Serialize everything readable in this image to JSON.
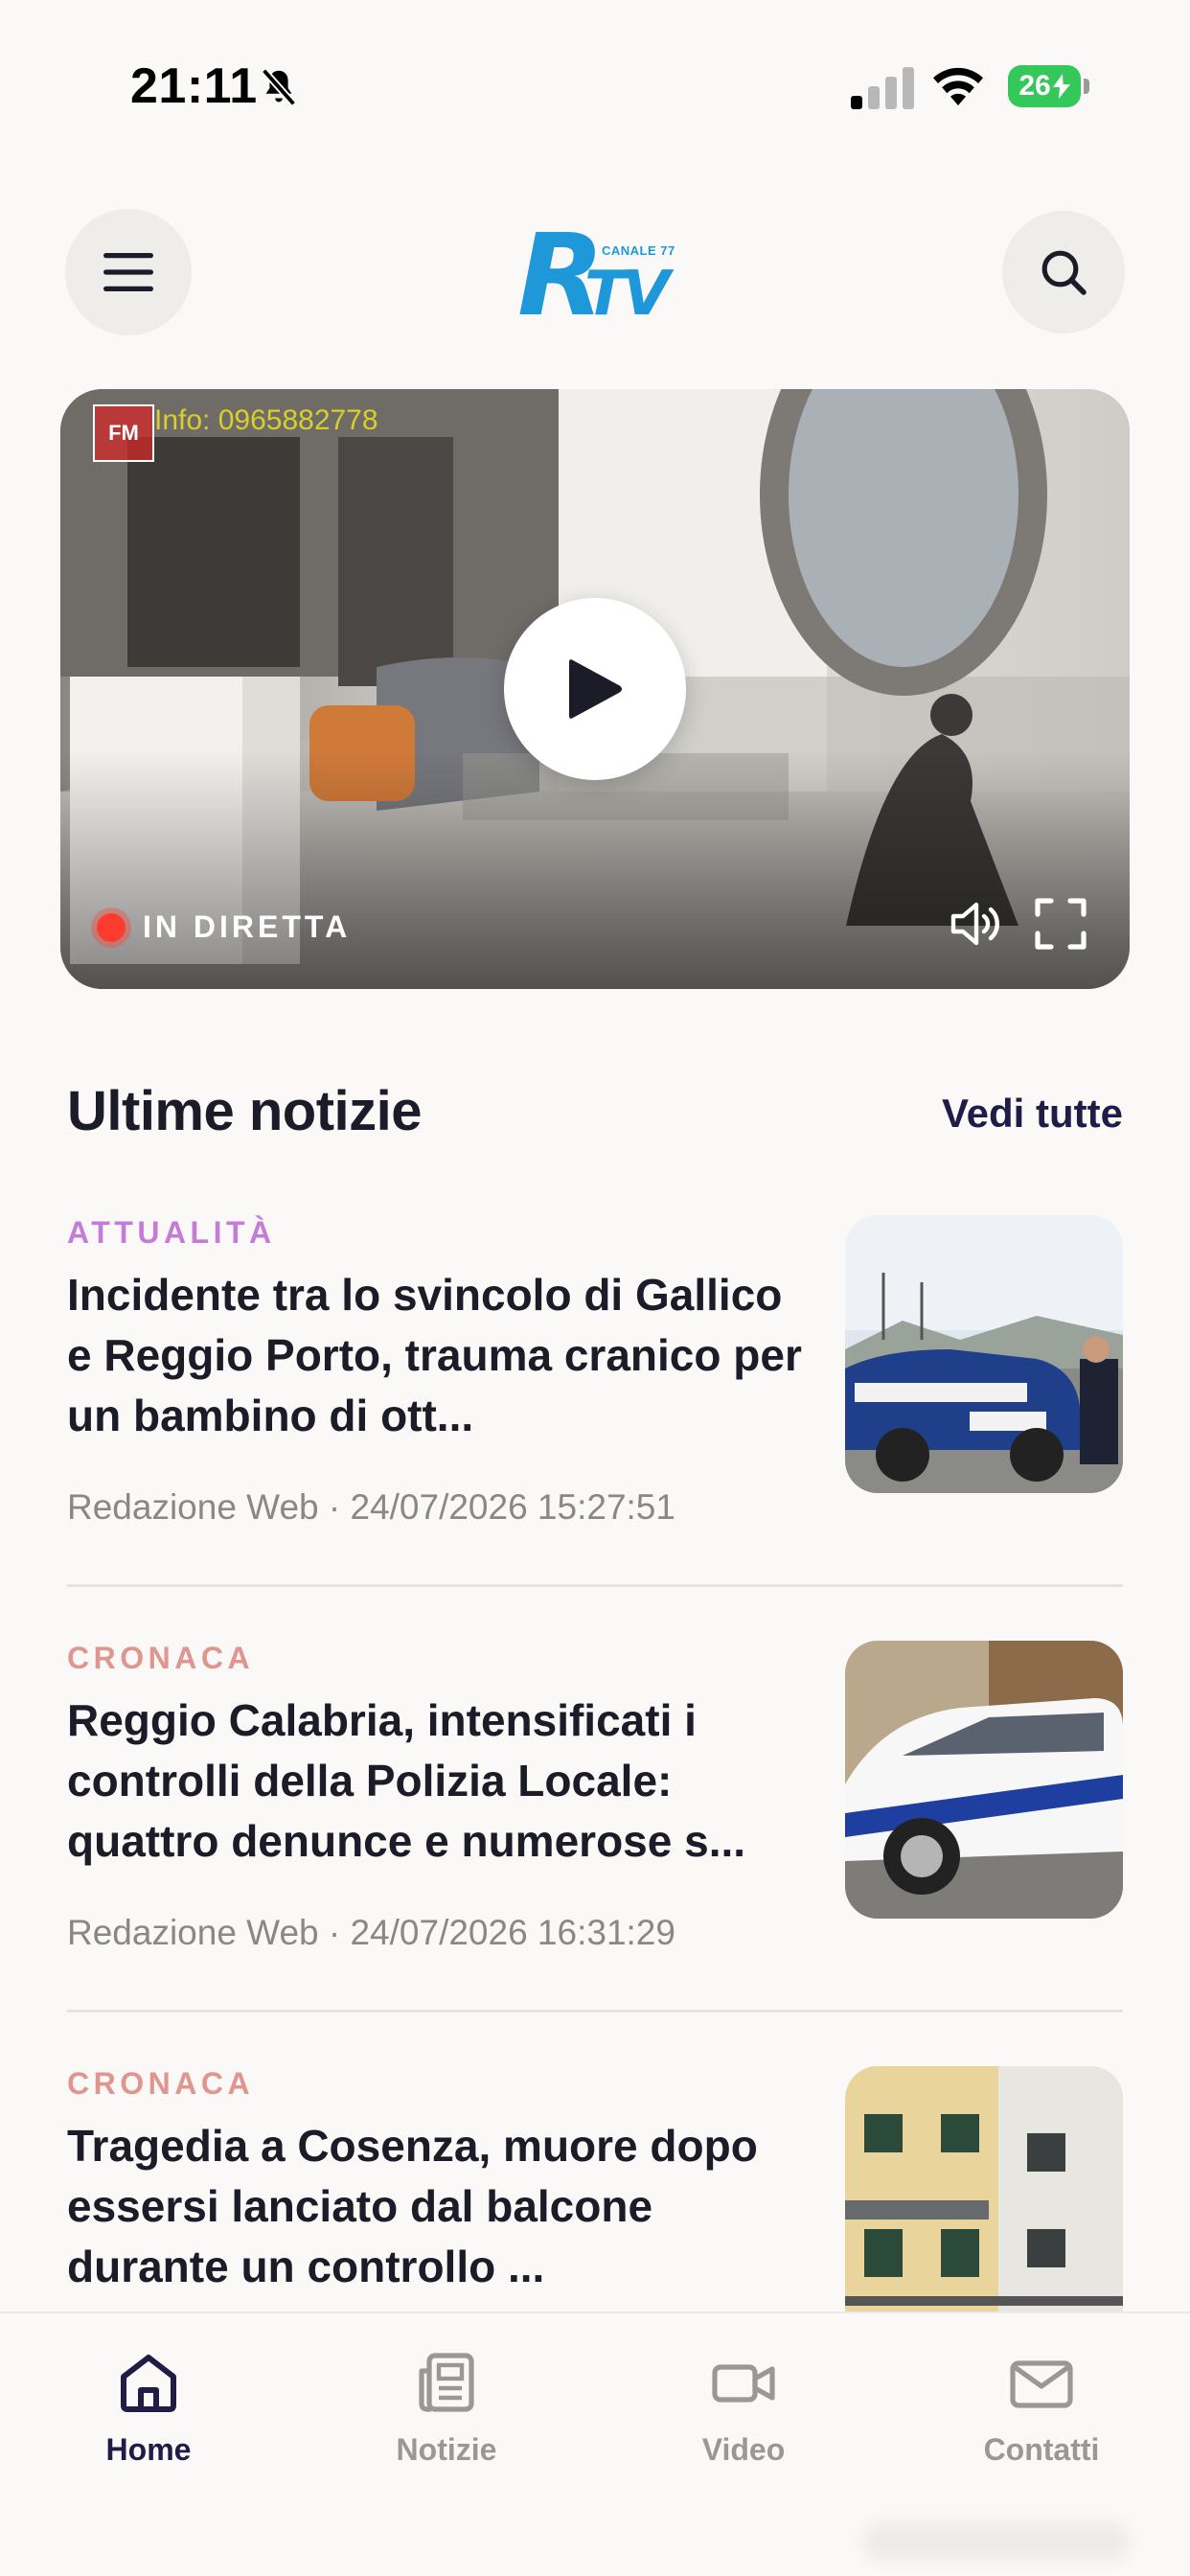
{
  "status_bar": {
    "time": "21:11",
    "battery_level": "26",
    "icons": [
      "bell-slash-icon",
      "cellular-signal-icon",
      "wifi-icon",
      "battery-charging-icon"
    ]
  },
  "header": {
    "menu_icon": "hamburger-menu-icon",
    "logo_main": "RTV",
    "logo_sub": "CANALE 77",
    "search_icon": "search-icon"
  },
  "player": {
    "watermark": "Info: 0965882778",
    "watermark_logo": "FM",
    "live_label": "IN DIRETTA",
    "icons": [
      "play-icon",
      "volume-icon",
      "fullscreen-icon"
    ]
  },
  "news": {
    "title": "Ultime notizie",
    "see_all": "Vedi tutte",
    "items": [
      {
        "category": "ATTUALITÀ",
        "category_color": "#c57bd8",
        "title": "Incidente tra lo svincolo di Gallico e Reggio Porto, trauma cranico per un bambino di ott...",
        "meta": "Redazione Web · 24/07/2026 15:27:51"
      },
      {
        "category": "CRONACA",
        "category_color": "#e0958f",
        "title": "Reggio Calabria, intensificati i controlli della Polizia Locale: quattro denunce e numerose s...",
        "meta": "Redazione Web · 24/07/2026 16:31:29"
      },
      {
        "category": "CRONACA",
        "category_color": "#e0958f",
        "title": "Tragedia a Cosenza, muore dopo essersi lanciato dal balcone durante un controllo ...",
        "meta": ""
      }
    ]
  },
  "tabbar": {
    "tabs": [
      {
        "label": "Home",
        "icon": "home-icon",
        "active": true
      },
      {
        "label": "Notizie",
        "icon": "newspaper-icon",
        "active": false
      },
      {
        "label": "Video",
        "icon": "video-camera-icon",
        "active": false
      },
      {
        "label": "Contatti",
        "icon": "mail-icon",
        "active": false
      }
    ]
  },
  "colors": {
    "background": "#faf9f8",
    "accent_navy": "#1f1d48",
    "logo_blue": "#1e98d8",
    "live_red": "#ff3b30",
    "battery_green": "#34c759"
  }
}
